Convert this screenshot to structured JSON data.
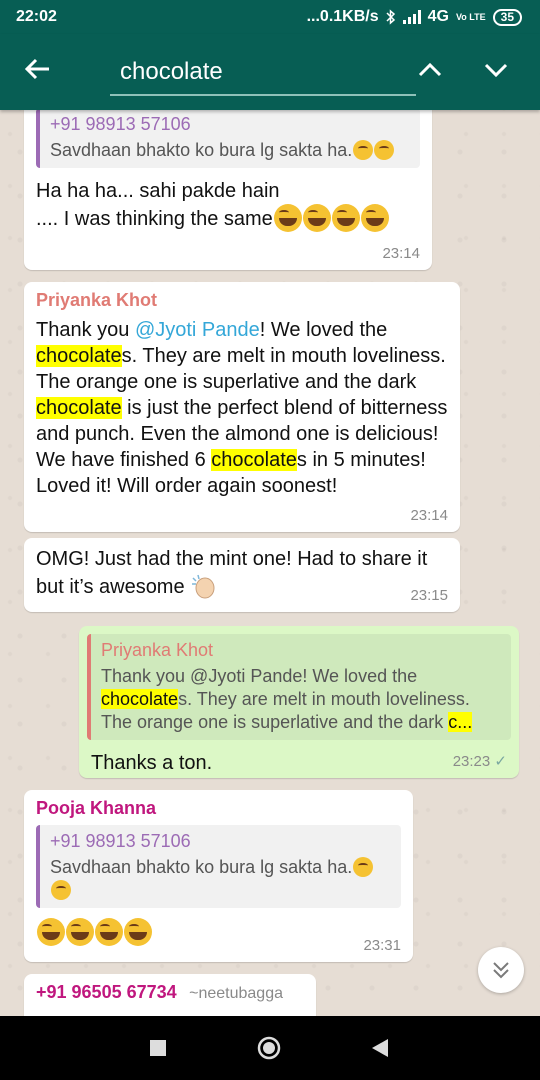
{
  "status_bar": {
    "time": "22:02",
    "network_speed": "...0.1KB/s",
    "network": "4G",
    "volte": "Vo LTE",
    "battery": "35"
  },
  "search": {
    "query": "chocolate"
  },
  "messages": [
    {
      "quote_name": "+91 98913 57106",
      "quote_text": "Savdhaan bhakto ko bura lg sakta ha.",
      "text_line1": "Ha ha ha... sahi pakde hain",
      "text_line2": ".... I was thinking the same",
      "time": "23:14"
    },
    {
      "sender": "Priyanka Khot",
      "mention": "@Jyoti Pande",
      "t1": "Thank you ",
      "t2": "! We loved the",
      "h1": "chocolate",
      "t3": "s. They are melt in mouth loveliness. The orange one is superlative and the dark ",
      "h2": "chocolate",
      "t4": " is just the perfect blend of bitterness and punch. Even the almond one is delicious! We have finished 6 ",
      "h3": "chocolate",
      "t5": "s in 5 minutes! Loved it! Will order again soonest!",
      "time": "23:14"
    },
    {
      "text": "OMG! Just had the mint one! Had to share it but it’s awesome",
      "time": "23:15"
    },
    {
      "quote_name": "Priyanka Khot",
      "q1": "Thank you @Jyoti Pande! We loved the",
      "qh": "chocolate",
      "q2": "s. They are melt in mouth loveliness.",
      "q3": "The orange one is superlative and the dark ",
      "qh2": "c...",
      "text": "Thanks a ton.",
      "time": "23:23",
      "tick": "✓"
    },
    {
      "sender": "Pooja Khanna",
      "quote_name": "+91 98913 57106",
      "quote_text": "Savdhaan bhakto ko bura lg sakta ha.",
      "time": "23:31"
    },
    {
      "sender": "+91 96505 67734",
      "sender_alias": "~neetubagga"
    }
  ],
  "colors": {
    "header": "#075e54",
    "highlight": "#ffff00",
    "outgoing_bubble": "#dcf8c6"
  }
}
